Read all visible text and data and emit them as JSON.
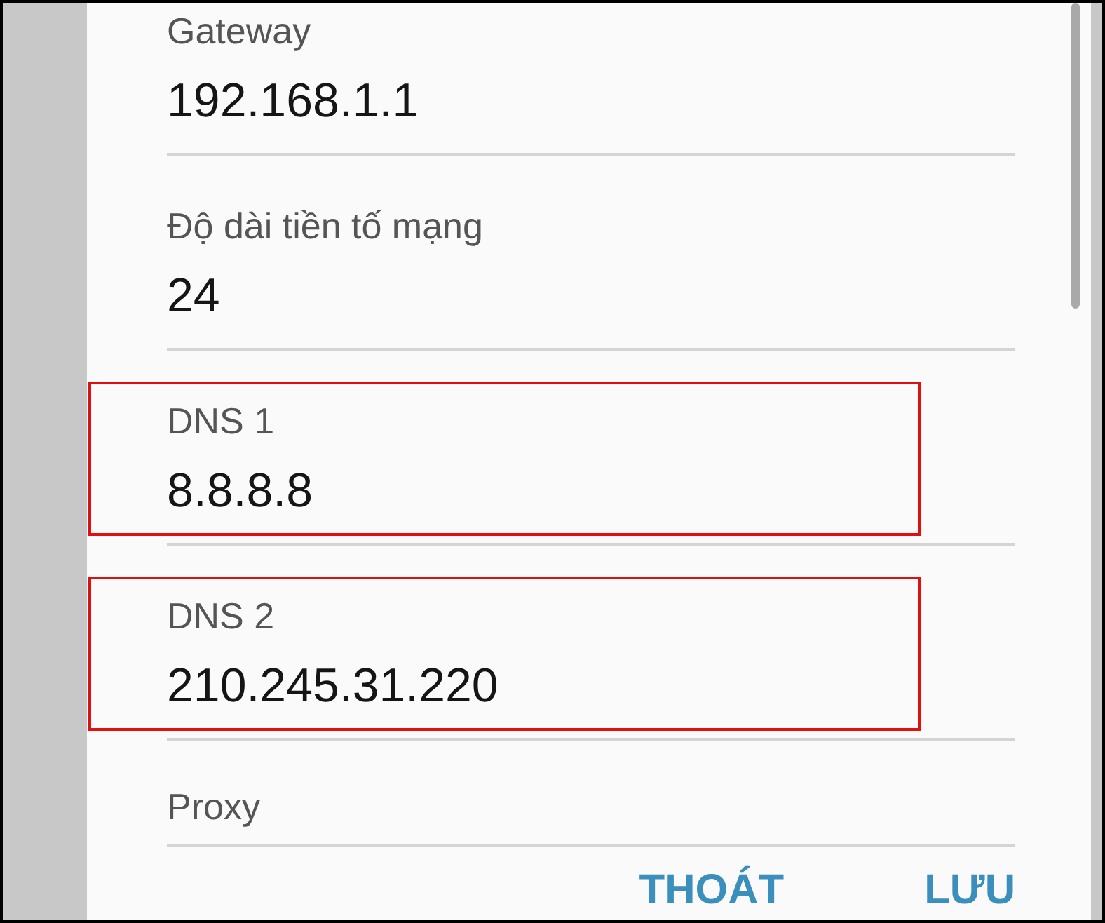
{
  "fields": [
    {
      "label": "Gateway",
      "value": "192.168.1.1",
      "highlighted": false
    },
    {
      "label": "Độ dài tiền tố mạng",
      "value": "24",
      "highlighted": false
    },
    {
      "label": "DNS 1",
      "value": "8.8.8.8",
      "highlighted": true
    },
    {
      "label": "DNS 2",
      "value": "210.245.31.220",
      "highlighted": true
    },
    {
      "label": "Proxy",
      "highlighted": false
    }
  ],
  "buttons": [
    {
      "label": "THOÁT"
    },
    {
      "label": "LƯU"
    }
  ]
}
